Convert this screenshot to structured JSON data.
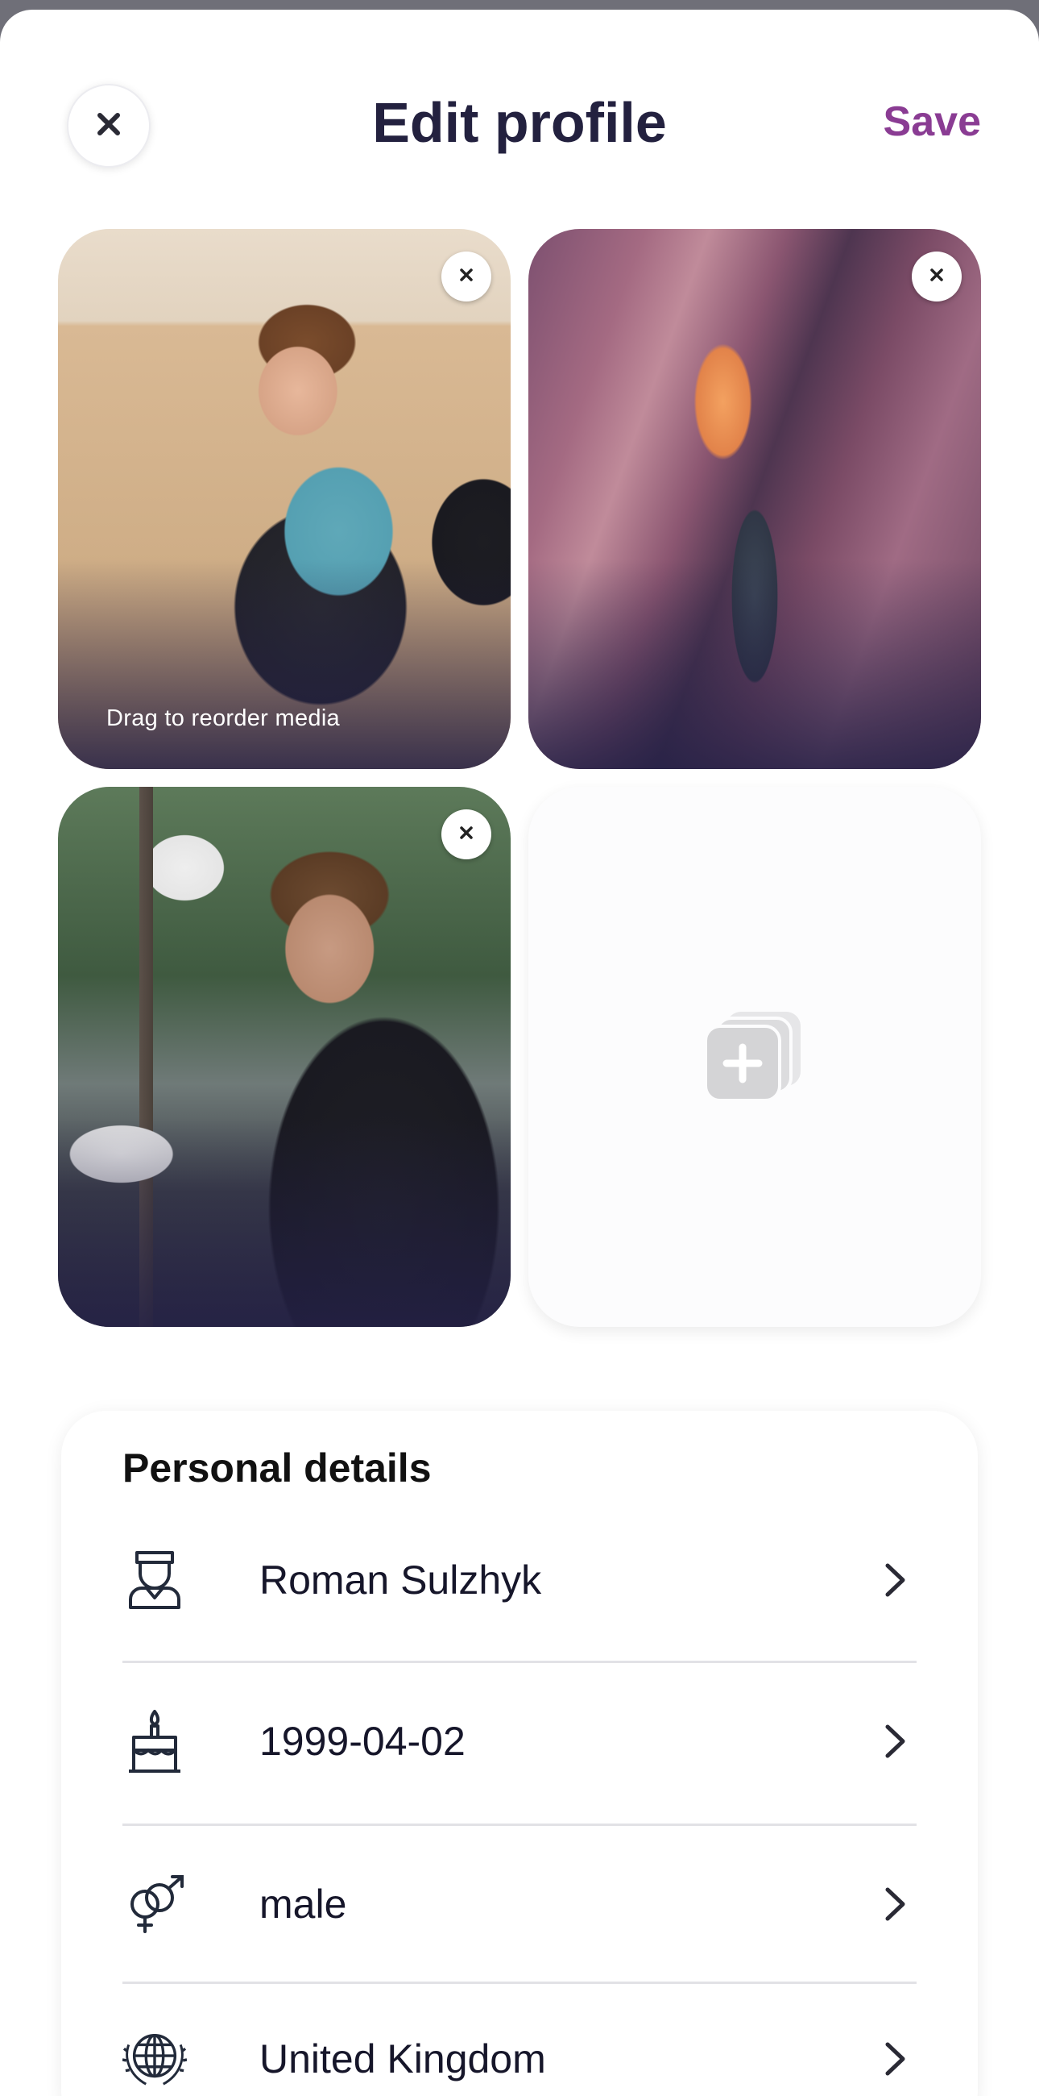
{
  "header": {
    "title": "Edit profile",
    "save_label": "Save",
    "close_icon": "close-icon"
  },
  "photos": {
    "reorder_hint": "Drag to reorder media",
    "items": [
      {
        "description": "man with sunglasses holding balloon on couch"
      },
      {
        "description": "man standing in slot canyon"
      },
      {
        "description": "man holding phone on street"
      }
    ],
    "add_icon": "add-photo-icon"
  },
  "personal_details": {
    "title": "Personal details",
    "rows": [
      {
        "icon": "person-icon",
        "value": "Roman Sulzhyk"
      },
      {
        "icon": "birthday-cake-icon",
        "value": "1999-04-02"
      },
      {
        "icon": "gender-icon",
        "value": "male"
      },
      {
        "icon": "globe-icon",
        "value": "United Kingdom"
      }
    ]
  },
  "colors": {
    "title": "#23213f",
    "accent": "#8a3c93",
    "text": "#16162a"
  }
}
